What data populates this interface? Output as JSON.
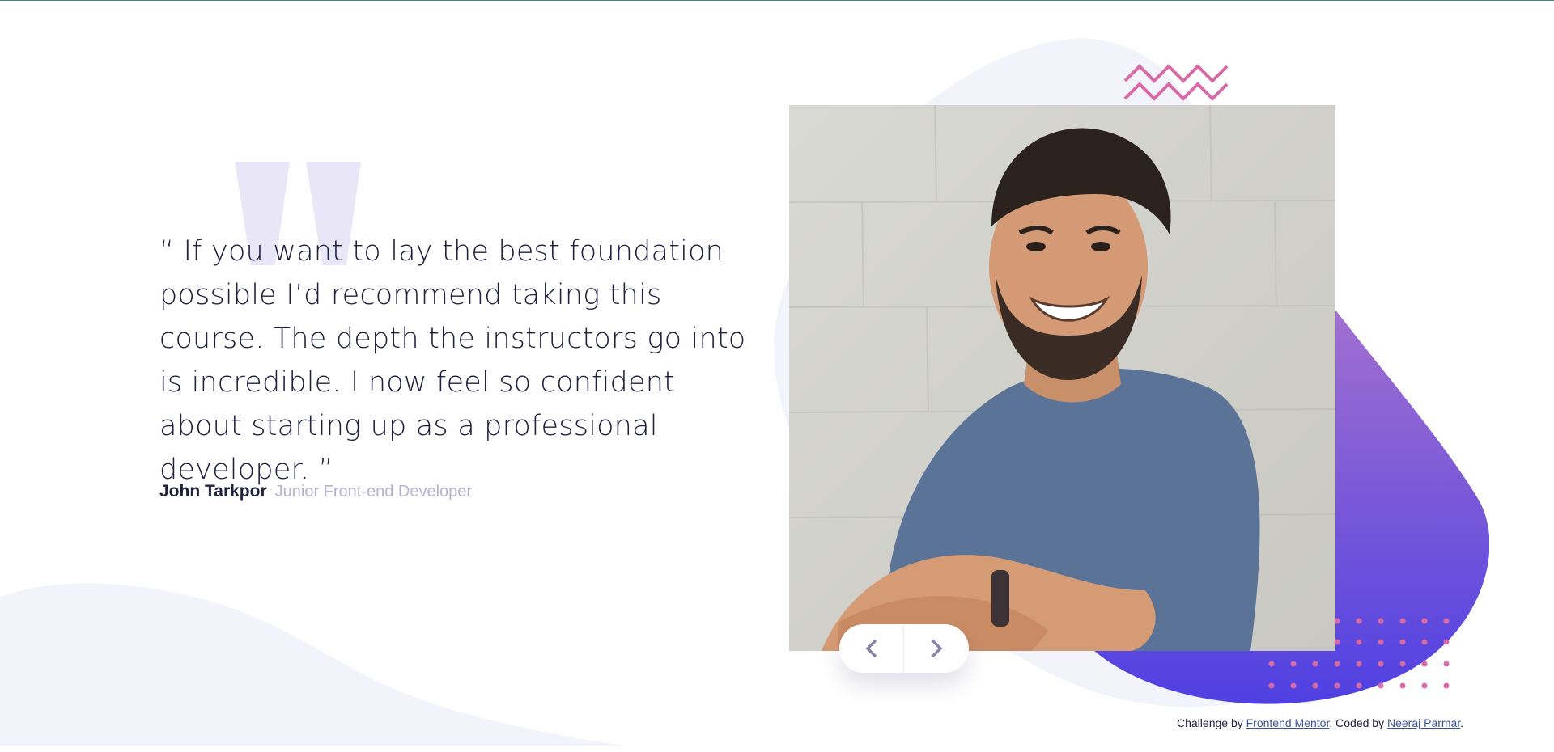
{
  "testimonial": {
    "quote": "“ If you want to lay the best foundation possible I’d recommend taking this course. The depth the instructors go into is incredible. I now feel so confident about starting up as a professional developer. ”",
    "author_name": "John Tarkpor",
    "author_role": "Junior Front-end Developer"
  },
  "navigation": {
    "prev_icon": "chevron-left-icon",
    "next_icon": "chevron-right-icon"
  },
  "attribution": {
    "prefix": "Challenge by ",
    "link1": "Frontend Mentor",
    "middle": ". Coded by ",
    "link2": "Neeraj Parmar",
    "suffix": "."
  },
  "colors": {
    "dark_navy": "#202040",
    "grayish_blue": "#b5b3d3",
    "gradient_top": "#a371cf",
    "gradient_bottom": "#4f40e2",
    "accent_pink": "#d76ba8",
    "light_bg": "#f3f3fb"
  }
}
